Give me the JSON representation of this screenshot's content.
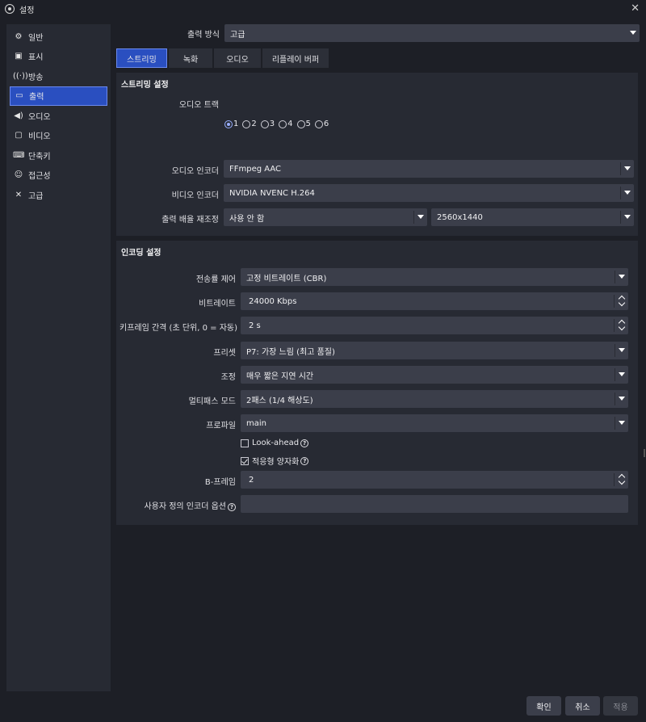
{
  "window": {
    "title": "설정"
  },
  "sidebar": {
    "items": [
      {
        "label": "일반",
        "icon": "gear-icon"
      },
      {
        "label": "표시",
        "icon": "display-icon"
      },
      {
        "label": "방송",
        "icon": "broadcast-icon"
      },
      {
        "label": "출력",
        "icon": "output-icon",
        "active": true
      },
      {
        "label": "오디오",
        "icon": "speaker-icon"
      },
      {
        "label": "비디오",
        "icon": "monitor-icon"
      },
      {
        "label": "단축키",
        "icon": "keyboard-icon"
      },
      {
        "label": "접근성",
        "icon": "accessibility-icon"
      },
      {
        "label": "고급",
        "icon": "tools-icon"
      }
    ]
  },
  "output_mode": {
    "label": "출력 방식",
    "value": "고급"
  },
  "tabs": [
    {
      "label": "스트리밍",
      "active": true
    },
    {
      "label": "녹화"
    },
    {
      "label": "오디오"
    },
    {
      "label": "리플레이 버퍼"
    }
  ],
  "streaming": {
    "title": "스트리밍 설정",
    "audio_track_label": "오디오 트랙",
    "tracks": [
      "1",
      "2",
      "3",
      "4",
      "5",
      "6"
    ],
    "selected_track": "1",
    "audio_encoder": {
      "label": "오디오 인코더",
      "value": "FFmpeg AAC"
    },
    "video_encoder": {
      "label": "비디오 인코더",
      "value": "NVIDIA NVENC H.264"
    },
    "rescale": {
      "label": "출력 배율 재조정",
      "value": "사용 안 함",
      "resolution": "2560x1440"
    }
  },
  "encoding": {
    "title": "인코딩 설정",
    "rate_control": {
      "label": "전송률 제어",
      "value": "고정 비트레이트 (CBR)"
    },
    "bitrate": {
      "label": "비트레이트",
      "value": "24000 Kbps"
    },
    "keyframe": {
      "label": "키프레임 간격 (초 단위, 0 = 자동)",
      "value": "2 s"
    },
    "preset": {
      "label": "프리셋",
      "value": "P7: 가장 느림 (최고 품질)"
    },
    "tuning": {
      "label": "조정",
      "value": "매우 짧은 지연 시간"
    },
    "multipass": {
      "label": "멀티패스 모드",
      "value": "2패스 (1/4 해상도)"
    },
    "profile": {
      "label": "프로파일",
      "value": "main"
    },
    "lookahead": {
      "label": "Look-ahead",
      "checked": false
    },
    "adaptive_quant": {
      "label": "적응형 양자화",
      "checked": true
    },
    "bframes": {
      "label": "B-프레임",
      "value": "2"
    },
    "custom_options": {
      "label": "사용자 정의 인코더 옵션",
      "value": ""
    }
  },
  "footer": {
    "ok": "확인",
    "cancel": "취소",
    "apply": "적용"
  },
  "colors": {
    "accent": "#2a4fc0",
    "background": "#1d1f26",
    "panel": "#272a33",
    "control": "#3b3e4a"
  }
}
